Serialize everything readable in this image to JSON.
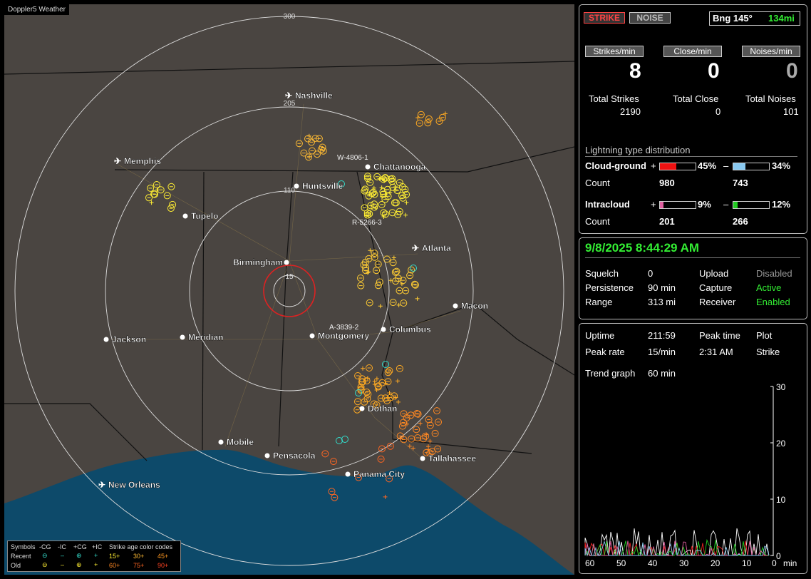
{
  "app_title": "Doppler5 Weather",
  "map": {
    "range_labels": [
      "300",
      "205",
      "110",
      "15"
    ],
    "cities": [
      {
        "name": "Nashville",
        "airport": true
      },
      {
        "name": "Memphis",
        "airport": true
      },
      {
        "name": "Chattanooga",
        "airport": false
      },
      {
        "name": "Huntsville",
        "airport": false
      },
      {
        "name": "Tupelo",
        "airport": false
      },
      {
        "name": "Atlanta",
        "airport": true
      },
      {
        "name": "Birmingham",
        "airport": false
      },
      {
        "name": "Macon",
        "airport": false
      },
      {
        "name": "Jackson",
        "airport": false
      },
      {
        "name": "Meridian",
        "airport": false
      },
      {
        "name": "Montgomery",
        "airport": false
      },
      {
        "name": "Columbus",
        "airport": false
      },
      {
        "name": "Dothan",
        "airport": false
      },
      {
        "name": "Mobile",
        "airport": false
      },
      {
        "name": "Pensacola",
        "airport": false
      },
      {
        "name": "Tallahassee",
        "airport": false
      },
      {
        "name": "Panama City",
        "airport": false
      },
      {
        "name": "New Orleans",
        "airport": true
      }
    ],
    "storm_labels": [
      "W-4806-1",
      "R-5266-3",
      "A-3839-2"
    ]
  },
  "legend": {
    "symbols_label": "Symbols",
    "headers": [
      "-CG",
      "-IC",
      "+CG",
      "+IC"
    ],
    "recent_label": "Recent",
    "old_label": "Old",
    "age_title": "Strike age color codes",
    "ages_row1": [
      "15+",
      "30+",
      "45+"
    ],
    "ages_row2": [
      "60+",
      "75+",
      "90+"
    ]
  },
  "top": {
    "strike_btn": "STRIKE",
    "noise_btn": "NOISE",
    "bearing": "Bng 145°",
    "distance": "134mi",
    "rate_buttons": [
      "Strikes/min",
      "Close/min",
      "Noises/min"
    ],
    "rates": [
      "8",
      "0",
      "0"
    ],
    "total_labels": [
      "Total Strikes",
      "Total Close",
      "Total Noises"
    ],
    "totals": [
      "2190",
      "0",
      "101"
    ],
    "dist_title": "Lightning type distribution",
    "cg_label": "Cloud-ground",
    "cg_plus_pct": "45%",
    "cg_minus_pct": "34%",
    "count_label": "Count",
    "cg_plus_count": "980",
    "cg_minus_count": "743",
    "ic_label": "Intracloud",
    "ic_plus_pct": "9%",
    "ic_minus_pct": "12%",
    "ic_plus_count": "201",
    "ic_minus_count": "266",
    "plus_sign": "+",
    "minus_sign": "–",
    "fill": {
      "cg_plus": 0.45,
      "cg_minus": 0.34,
      "ic_plus": 0.09,
      "ic_minus": 0.12
    },
    "colors": {
      "cg_plus": "#ee1111",
      "cg_minus": "#88c8f0",
      "ic_plus": "#e060a0",
      "ic_minus": "#22cc22"
    }
  },
  "status": {
    "datetime": "9/8/2025 8:44:29 AM",
    "rows": [
      {
        "k1": "Squelch",
        "v1": "0",
        "k2": "Upload",
        "v2": "Disabled"
      },
      {
        "k1": "Persistence",
        "v1": "90 min",
        "k2": "Capture",
        "v2": "Active"
      },
      {
        "k1": "Range",
        "v1": "313 mi",
        "k2": "Receiver",
        "v2": "Enabled"
      }
    ]
  },
  "trend": {
    "uptime_label": "Uptime",
    "uptime": "211:59",
    "peak_time_label": "Peak time",
    "plot_label": "Plot",
    "peak_rate_label": "Peak rate",
    "peak_rate": "15/min",
    "peak_time": "2:31 AM",
    "plot_value": "Strike",
    "trend_label": "Trend graph",
    "trend_window": "60 min",
    "y_ticks": [
      "30",
      "20",
      "10",
      "0"
    ],
    "x_ticks": [
      "60",
      "50",
      "40",
      "30",
      "20",
      "10",
      "0"
    ],
    "x_unit": "min"
  }
}
